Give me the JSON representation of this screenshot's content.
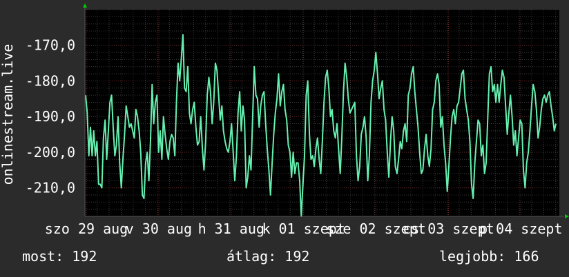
{
  "chart_data": {
    "type": "line",
    "ylabel": "onlinestream.live",
    "y_ticks": [
      "-170,0",
      "-180,0",
      "-190,0",
      "-200,0",
      "-210,0"
    ],
    "y_tick_values": [
      -170,
      -180,
      -190,
      -200,
      -210
    ],
    "x_ticks": [
      "szo 29 aug",
      "v 30 aug",
      "h 31 aug",
      "k 01 szept",
      "sze 02 szept",
      "cs 03 szept",
      "p 04 szept"
    ],
    "ylim": [
      -218,
      -160
    ],
    "grid": true,
    "series": [
      {
        "color": "#66f0b0",
        "values": [
          -184,
          -189,
          -201,
          -193,
          -201,
          -194,
          -201,
          -197,
          -209,
          -209,
          -210,
          -196,
          -191,
          -202,
          -194,
          -186,
          -184,
          -193,
          -201,
          -198,
          -190,
          -203,
          -210,
          -202,
          -195,
          -187,
          -190,
          -193,
          -192,
          -194,
          -196,
          -188,
          -190,
          -194,
          -200,
          -212,
          -213,
          -203,
          -200,
          -208,
          -197,
          -181,
          -192,
          -186,
          -184,
          -200,
          -194,
          -202,
          -190,
          -195,
          -199,
          -202,
          -197,
          -195,
          -196,
          -201,
          -186,
          -175,
          -180,
          -174,
          -167,
          -182,
          -183,
          -176,
          -189,
          -192,
          -188,
          -186,
          -193,
          -198,
          -197,
          -190,
          -199,
          -205,
          -197,
          -184,
          -179,
          -183,
          -192,
          -186,
          -175,
          -177,
          -184,
          -191,
          -187,
          -194,
          -197,
          -199,
          -200,
          -197,
          -192,
          -200,
          -208,
          -201,
          -189,
          -183,
          -194,
          -187,
          -191,
          -210,
          -207,
          -201,
          -205,
          -190,
          -176,
          -184,
          -185,
          -193,
          -187,
          -184,
          -183,
          -192,
          -199,
          -205,
          -212,
          -203,
          -195,
          -189,
          -185,
          -178,
          -187,
          -183,
          -181,
          -188,
          -191,
          -198,
          -200,
          -207,
          -200,
          -206,
          -203,
          -203,
          -208,
          -218,
          -209,
          -201,
          -184,
          -180,
          -195,
          -202,
          -201,
          -204,
          -199,
          -196,
          -202,
          -206,
          -197,
          -186,
          -179,
          -177,
          -182,
          -190,
          -188,
          -194,
          -196,
          -192,
          -199,
          -206,
          -196,
          -183,
          -175,
          -179,
          -185,
          -189,
          -188,
          -187,
          -186,
          -201,
          -208,
          -204,
          -195,
          -193,
          -190,
          -196,
          -208,
          -201,
          -186,
          -180,
          -177,
          -172,
          -178,
          -185,
          -182,
          -180,
          -188,
          -191,
          -200,
          -207,
          -197,
          -190,
          -194,
          -204,
          -206,
          -202,
          -197,
          -199,
          -194,
          -192,
          -197,
          -184,
          -182,
          -178,
          -176,
          -183,
          -188,
          -193,
          -200,
          -206,
          -205,
          -199,
          -195,
          -201,
          -204,
          -199,
          -188,
          -186,
          -180,
          -178,
          -181,
          -193,
          -190,
          -198,
          -203,
          -211,
          -204,
          -196,
          -190,
          -188,
          -192,
          -187,
          -186,
          -182,
          -178,
          -177,
          -185,
          -188,
          -191,
          -197,
          -209,
          -213,
          -203,
          -197,
          -191,
          -192,
          -201,
          -198,
          -206,
          -203,
          -190,
          -178,
          -176,
          -183,
          -181,
          -186,
          -181,
          -186,
          -181,
          -177,
          -179,
          -187,
          -195,
          -189,
          -184,
          -190,
          -198,
          -194,
          -201,
          -196,
          -191,
          -192,
          -205,
          -210,
          -203,
          -200,
          -194,
          -187,
          -181,
          -183,
          -188,
          -196,
          -193,
          -188,
          -185,
          -184,
          -186,
          -184,
          -183,
          -187,
          -190,
          -194,
          -192
        ]
      }
    ]
  },
  "stats": {
    "current": "most: 192",
    "average": "átlag: 192",
    "best": "legjobb: 166"
  },
  "colors": {
    "background": "#2b2b2b",
    "plot": "#000000",
    "line": "#66f0b0",
    "axis_arrow": "#00cc00",
    "minor_grid": "#3a3a3a",
    "major_grid": "#6a2a2a"
  }
}
